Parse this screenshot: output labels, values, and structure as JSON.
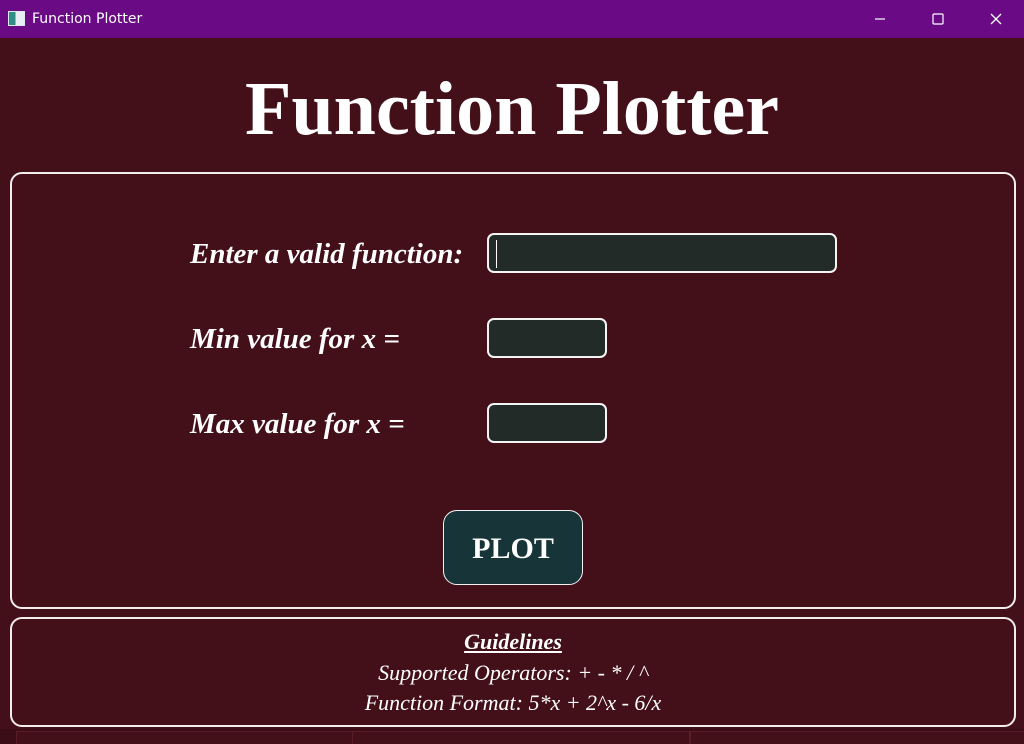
{
  "window": {
    "title": "Function Plotter",
    "icons": {
      "app": "function-plotter-app-icon",
      "minimize": "minimize-icon",
      "maximize": "maximize-icon",
      "close": "close-icon"
    },
    "colors": {
      "titlebar": "#6a0a84",
      "background": "#43101a",
      "text": "#ffffff"
    }
  },
  "header": {
    "title": "Function Plotter"
  },
  "form": {
    "function_label": "Enter a valid function:",
    "function_value": "",
    "function_placeholder": "",
    "min_label": "Min value for x =",
    "min_value": "",
    "min_placeholder": "",
    "max_label": "Max value for x =",
    "max_value": "",
    "max_placeholder": "",
    "plot_button": "PLOT",
    "colors": {
      "input_background": "#232b28",
      "button_background": "#173438",
      "border": "#f2eeee"
    }
  },
  "guidelines": {
    "heading": "Guidelines",
    "supported_operators": "Supported Operators: + - * / ^",
    "function_format": "Function Format: 5*x + 2^x - 6/x"
  }
}
